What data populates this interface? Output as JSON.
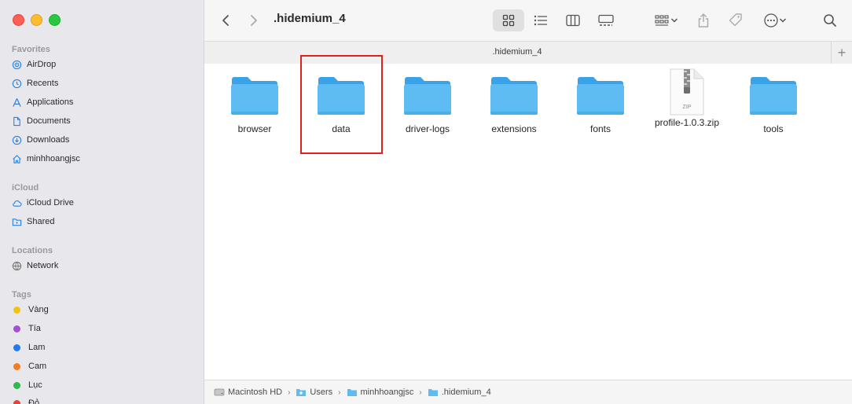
{
  "window": {
    "title": ".hidemium_4",
    "tab_title": ".hidemium_4",
    "tab_add": "+"
  },
  "sidebar": {
    "favorites_header": "Favorites",
    "favorites": [
      {
        "label": "AirDrop",
        "icon": "airdrop-icon"
      },
      {
        "label": "Recents",
        "icon": "clock-icon"
      },
      {
        "label": "Applications",
        "icon": "applications-icon"
      },
      {
        "label": "Documents",
        "icon": "document-icon"
      },
      {
        "label": "Downloads",
        "icon": "download-icon"
      },
      {
        "label": "minhhoangjsc",
        "icon": "home-icon"
      }
    ],
    "icloud_header": "iCloud",
    "icloud": [
      {
        "label": "iCloud Drive",
        "icon": "cloud-icon"
      },
      {
        "label": "Shared",
        "icon": "shared-folder-icon"
      }
    ],
    "locations_header": "Locations",
    "locations": [
      {
        "label": "Network",
        "icon": "network-icon"
      }
    ],
    "tags_header": "Tags",
    "tags": [
      {
        "label": "Vàng",
        "color": "#f4c20d"
      },
      {
        "label": "Tía",
        "color": "#a34fd6"
      },
      {
        "label": "Lam",
        "color": "#1f7cf0"
      },
      {
        "label": "Cam",
        "color": "#f57c1f"
      },
      {
        "label": "Lục",
        "color": "#2fb84b"
      },
      {
        "label": "Đỏ",
        "color": "#e8413b"
      }
    ]
  },
  "files": [
    {
      "name": "browser",
      "type": "folder"
    },
    {
      "name": "data",
      "type": "folder"
    },
    {
      "name": "driver-logs",
      "type": "folder"
    },
    {
      "name": "extensions",
      "type": "folder"
    },
    {
      "name": "fonts",
      "type": "folder"
    },
    {
      "name": "profile-1.0.3.zip",
      "type": "zip",
      "badge": "ZIP"
    },
    {
      "name": "tools",
      "type": "folder"
    }
  ],
  "pathbar": [
    {
      "label": "Macintosh HD",
      "icon": "disk-icon"
    },
    {
      "label": "Users",
      "icon": "folder-icon"
    },
    {
      "label": "minhhoangjsc",
      "icon": "folder-icon"
    },
    {
      "label": ".hidemium_4",
      "icon": "folder-icon"
    }
  ],
  "pathbar_separator": "›",
  "colors": {
    "folder": "#5fbcf3",
    "folder_tab": "#3aa2e6",
    "sidebar_icon": "#2a82e0",
    "highlight": "#e01f1f"
  }
}
